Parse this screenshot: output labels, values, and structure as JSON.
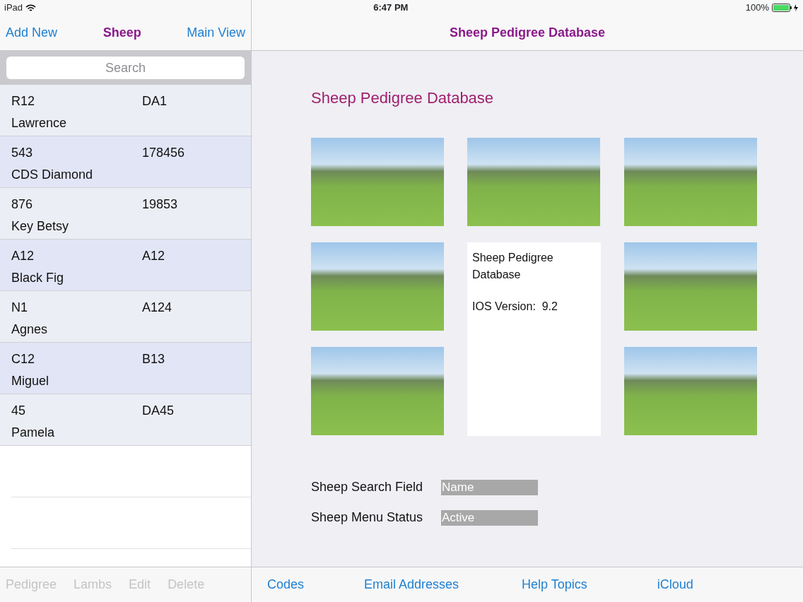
{
  "status_bar": {
    "device": "iPad",
    "time": "6:47 PM",
    "battery": "100%"
  },
  "master": {
    "nav": {
      "left": "Add New",
      "title": "Sheep",
      "right": "Main View"
    },
    "search": {
      "placeholder": "Search"
    },
    "rows": [
      {
        "id": "R12",
        "column_2": "DA1",
        "name": "Lawrence"
      },
      {
        "id": "543",
        "column_2": "178456",
        "name": "CDS Diamond"
      },
      {
        "id": "876",
        "column_2": "19853",
        "name": "Key Betsy"
      },
      {
        "id": "A12",
        "column_2": "A12",
        "name": "Black Fig"
      },
      {
        "id": "N1",
        "column_2": "A124",
        "name": "Agnes"
      },
      {
        "id": "C12",
        "column_2": "B13",
        "name": "Miguel"
      },
      {
        "id": "45",
        "column_2": "DA45",
        "name": "Pamela"
      }
    ],
    "toolbar": [
      {
        "label": "Pedigree",
        "disabled": true
      },
      {
        "label": "Lambs",
        "disabled": true
      },
      {
        "label": "Edit",
        "disabled": true
      },
      {
        "label": "Delete",
        "disabled": true
      }
    ]
  },
  "detail": {
    "nav": {
      "title": "Sheep Pedigree Database"
    },
    "heading": "Sheep Pedigree Database",
    "info": {
      "title": "Sheep Pedigree Database",
      "version": "IOS Version:  9.2"
    },
    "fields": [
      {
        "label": "Sheep Search Field",
        "value": "Name"
      },
      {
        "label": "Sheep Menu Status",
        "value": "Active"
      }
    ],
    "toolbar": [
      {
        "label": "Codes"
      },
      {
        "label": "Email Addresses"
      },
      {
        "label": "Help Topics"
      },
      {
        "label": "iCloud"
      }
    ]
  }
}
